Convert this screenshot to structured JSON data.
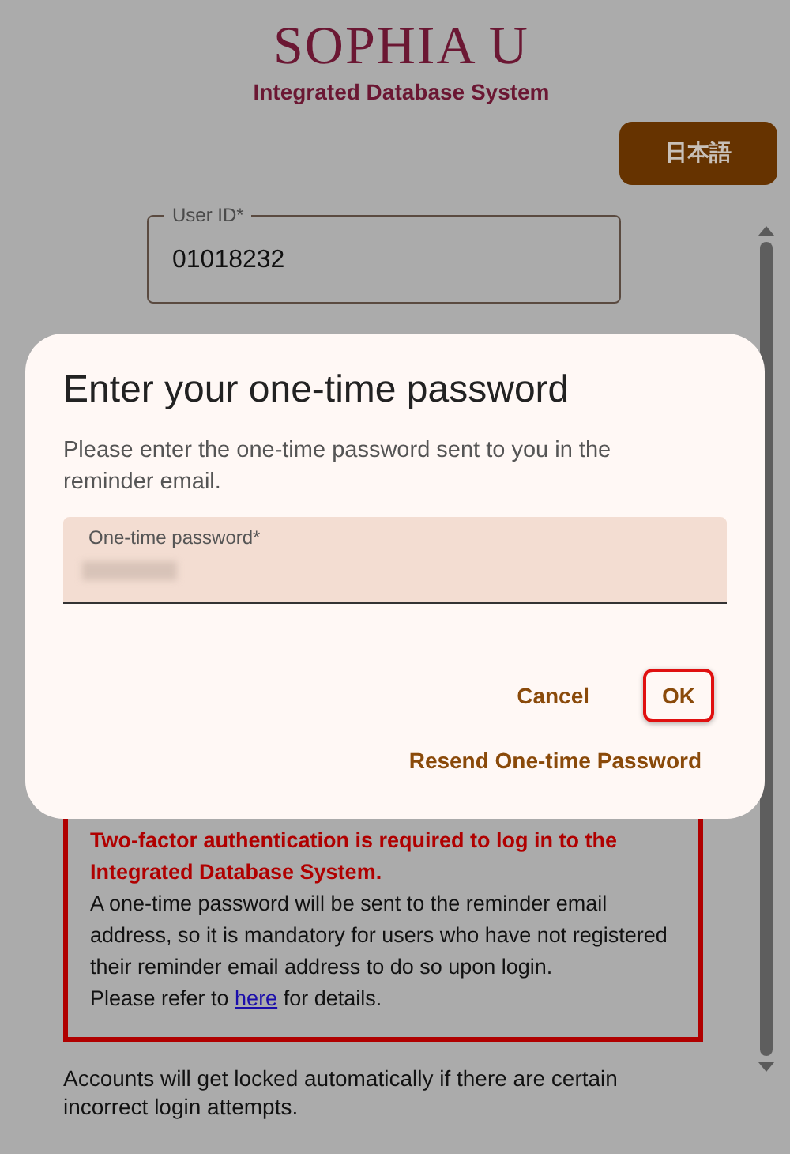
{
  "header": {
    "logo": "SOPHIA U",
    "subtitle": "Integrated Database System"
  },
  "language_button": {
    "label": "日本語"
  },
  "user_id_field": {
    "label": "User ID*",
    "value": "01018232"
  },
  "notice": {
    "heading": "Two-factor authentication is required to log in to the Integrated Database System.",
    "body": "A one-time password will be sent to the reminder email address, so it is mandatory for users who have not registered their reminder email address to do so upon login.",
    "refer": {
      "before": "Please refer to ",
      "link": "here",
      "after": " for details."
    }
  },
  "lock_notice": "Accounts will get locked automatically if there are certain incorrect login attempts.",
  "dialog": {
    "title": "Enter your one-time password",
    "message": "Please enter the one-time password sent to you in the reminder email.",
    "otp_field": {
      "label": "One-time password*",
      "redacted": true
    },
    "buttons": [
      {
        "label": "Cancel",
        "focused": false
      },
      {
        "label": "OK",
        "focused": true
      }
    ],
    "resend_link": "Resend One-time Password"
  }
}
